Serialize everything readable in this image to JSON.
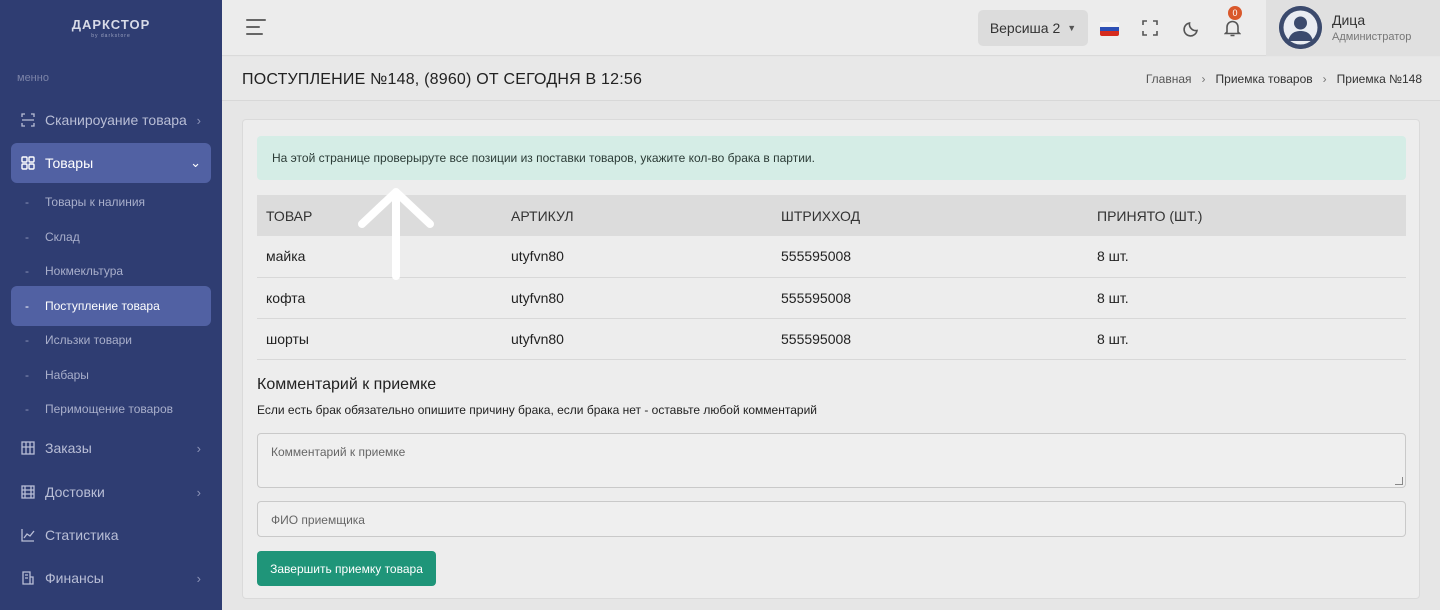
{
  "sidebar": {
    "logo_main": "ДАРКСТОР",
    "logo_sub": "by darkstore",
    "menu_caption": "менно",
    "items": [
      {
        "label": "Сканироуание товара",
        "icon": "scan-icon"
      },
      {
        "label": "Товары",
        "icon": "grid-icon"
      },
      {
        "label": "Заказы",
        "icon": "box-icon"
      },
      {
        "label": "Достовки",
        "icon": "truck-icon"
      },
      {
        "label": "Статистика",
        "icon": "chart-icon"
      },
      {
        "label": "Финансы",
        "icon": "finance-icon"
      }
    ],
    "sub_items": [
      {
        "label": "Товары к налиния"
      },
      {
        "label": "Склад"
      },
      {
        "label": "Нокмекльтура"
      },
      {
        "label": "Поступление товара"
      },
      {
        "label": "Исльзки товари"
      },
      {
        "label": "Набары"
      },
      {
        "label": "Перимощение товаров"
      }
    ]
  },
  "topbar": {
    "version_label": "Версиша 2",
    "notification_count": "0",
    "user_name": "Дица",
    "user_role": "Администратор"
  },
  "page": {
    "title": "ПОСТУПЛЕНИЕ №148, (8960) ОТ СЕГОДНЯ В 12:56",
    "breadcrumb": [
      "Главная",
      "Приемка товаров",
      "Приемка №148"
    ]
  },
  "main": {
    "alert": "На этой странице проверыруте все позиции из поставки товаров, укажите кол-во брака в партии.",
    "table": {
      "headers": [
        "ТОВАР",
        "АРТИКУЛ",
        "ШТРИХХОД",
        "ПРИНЯТО (ШТ.)"
      ],
      "rows": [
        [
          "майка",
          "utyfvn80",
          "555595008",
          "8 шт."
        ],
        [
          "кофта",
          "utyfvn80",
          "555595008",
          "8 шт."
        ],
        [
          "шорты",
          "utyfvn80",
          "555595008",
          "8 шт."
        ]
      ]
    },
    "comment_title": "Комментарий к приемке",
    "comment_note": "Если есть брак обязательно опишите причину брака, если брака нет - оставьте любой комментарий",
    "comment_placeholder": "Комментарий к приемке",
    "receiver_placeholder": "ФИО приемщика",
    "submit_label": "Завершить приемку товара"
  },
  "colors": {
    "sidebar_bg": "#2f3d72",
    "active_item": "#5161a3",
    "alert_bg": "#d5ede6",
    "submit_bg": "#1f9579",
    "badge": "#d9582b"
  }
}
